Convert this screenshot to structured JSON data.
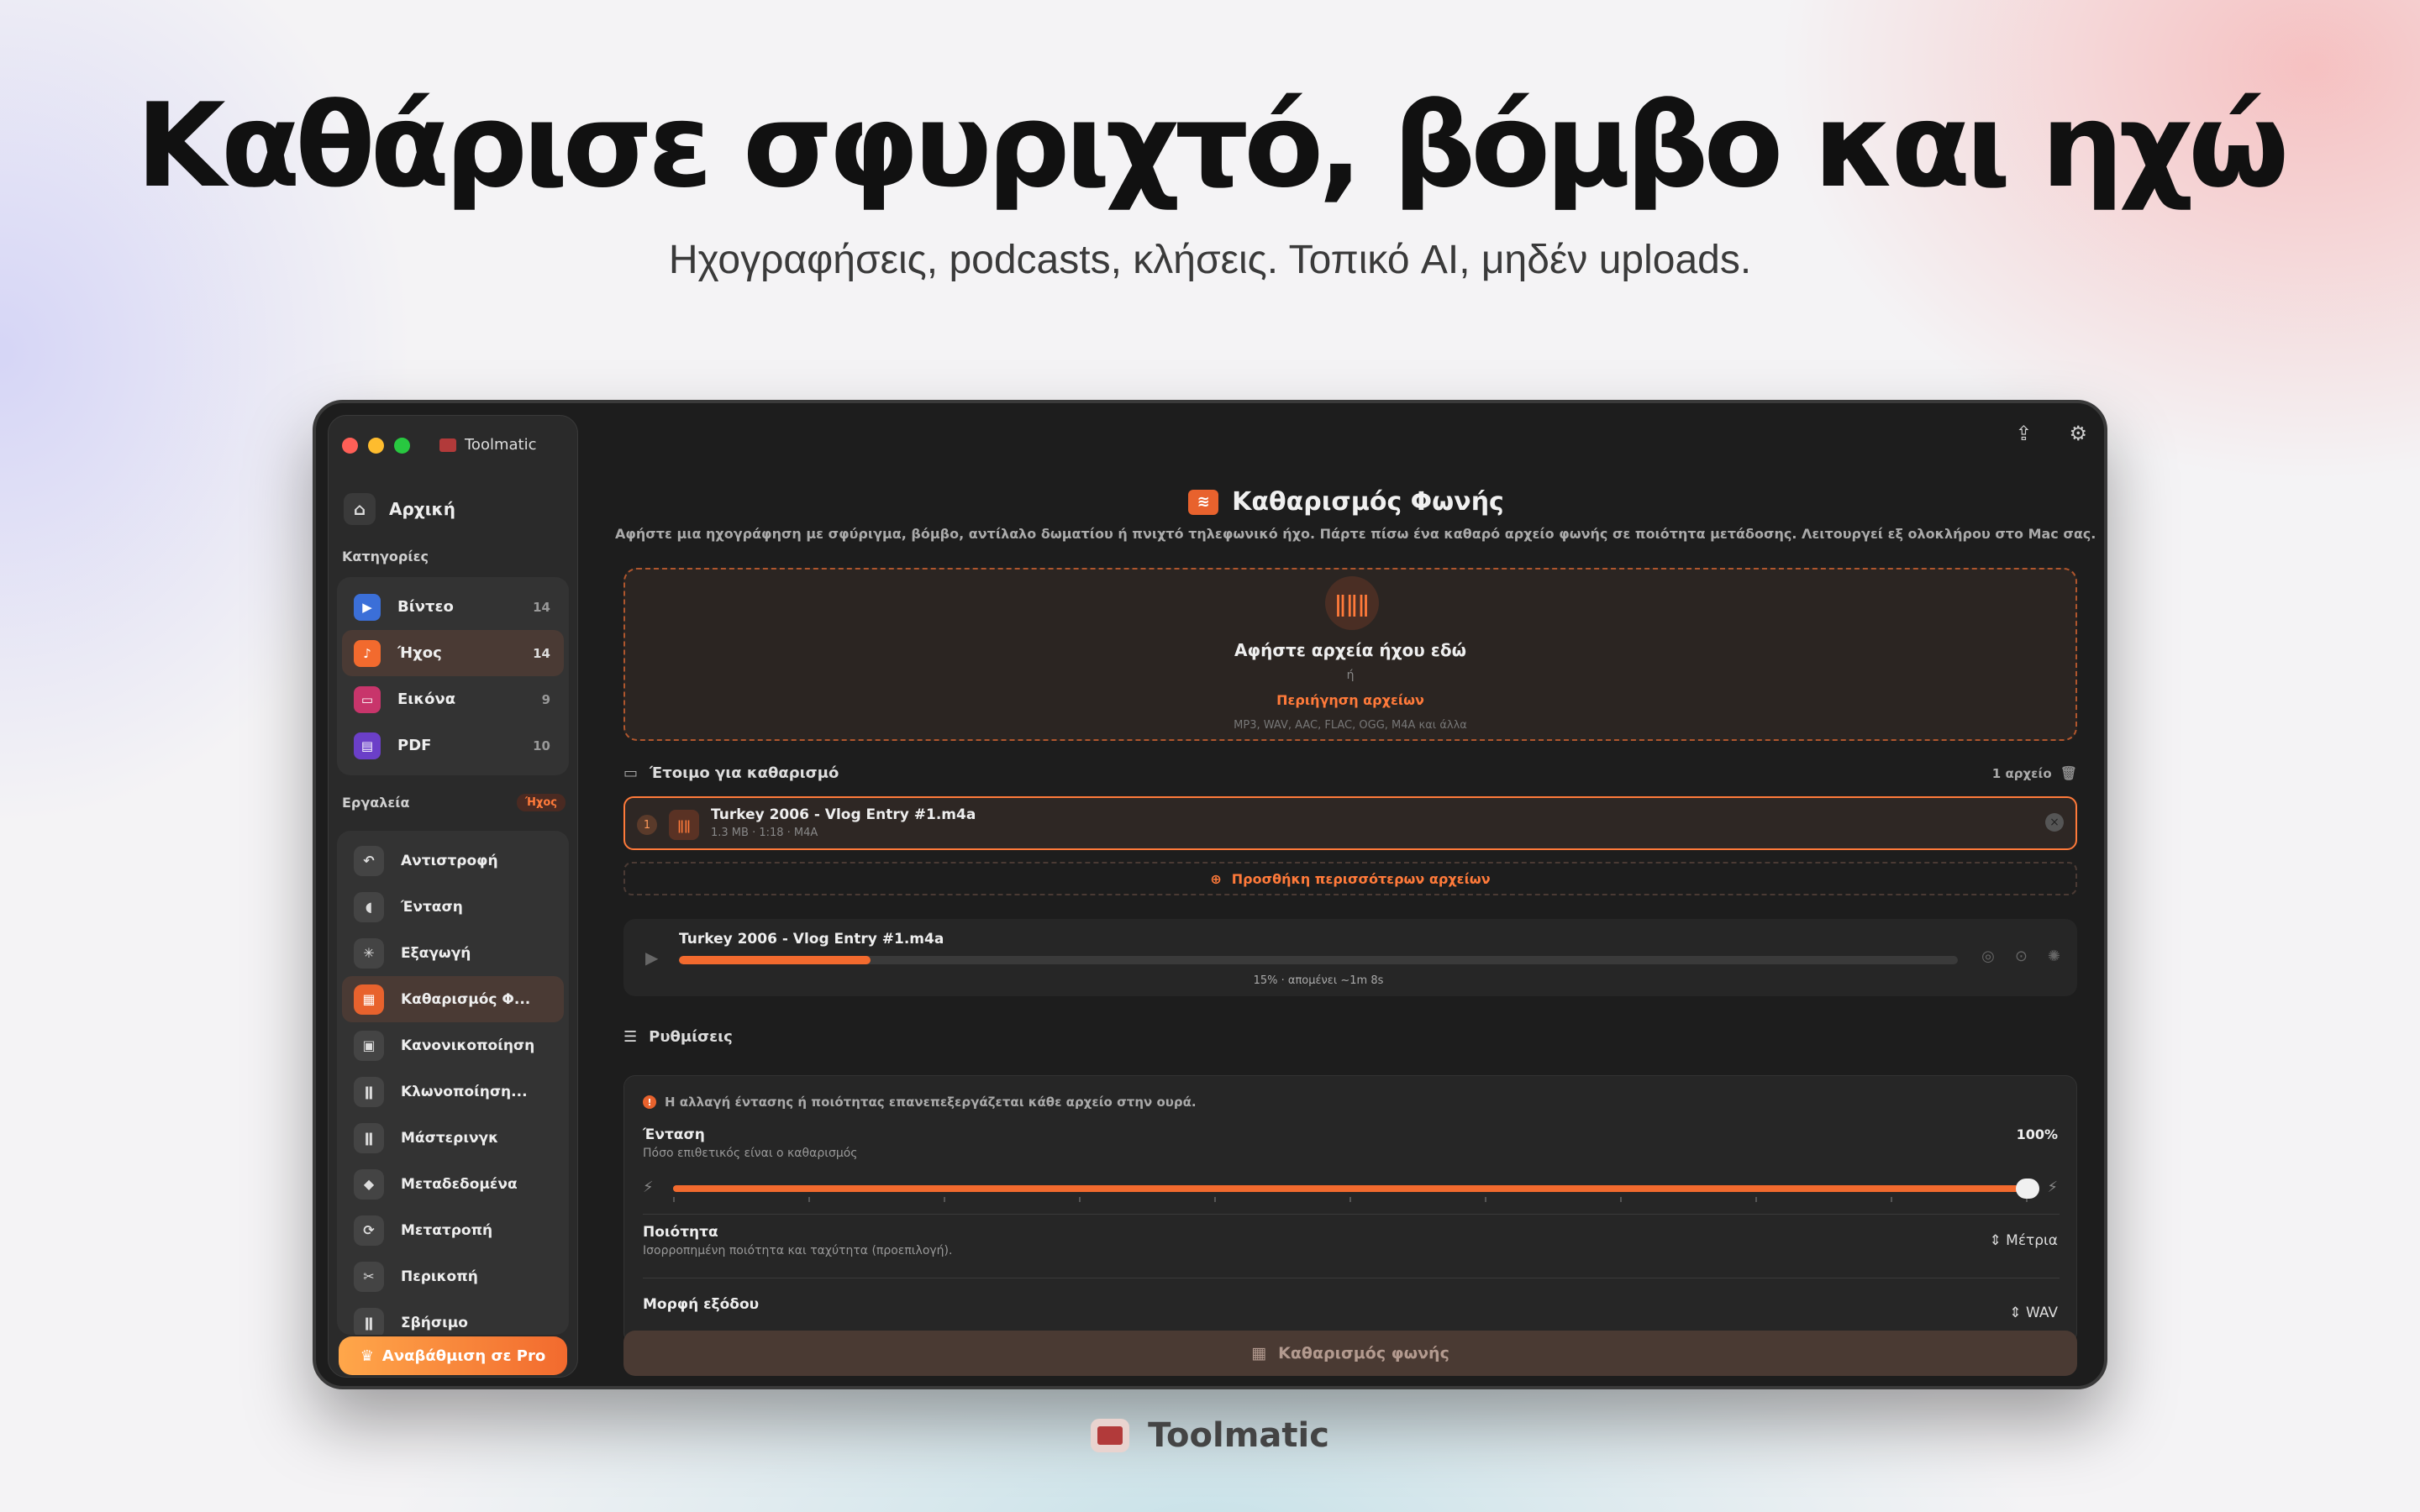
{
  "hero": {
    "headline": "Καθάρισε σφυριχτό, βόμβο και ηχώ",
    "subline": "Ηχογραφήσεις, podcasts, κλήσεις. Τοπικό AI, μηδέν uploads."
  },
  "window": {
    "app_title": "Toolmatic"
  },
  "sidebar": {
    "home_label": "Αρχική",
    "categories_label": "Κατηγορίες",
    "categories": [
      {
        "label": "Βίντεο",
        "count": "14",
        "color": "#3b6fd8",
        "icon": "play-icon"
      },
      {
        "label": "Ήχος",
        "count": "14",
        "color": "#f26a2e",
        "icon": "music-note-icon"
      },
      {
        "label": "Εικόνα",
        "count": "9",
        "color": "#c8356b",
        "icon": "image-icon"
      },
      {
        "label": "PDF",
        "count": "10",
        "color": "#6b3fc8",
        "icon": "document-icon"
      }
    ],
    "tools_label": "Εργαλεία",
    "tools_badge": "Ήχος",
    "tools": [
      {
        "label": "Αντιστροφή",
        "icon": "undo-icon"
      },
      {
        "label": "Ένταση",
        "icon": "speaker-icon"
      },
      {
        "label": "Εξαγωγή",
        "icon": "waveform-icon"
      },
      {
        "label": "Καθαρισμός Φ...",
        "icon": "voice-clean-icon"
      },
      {
        "label": "Κανονικοποίηση",
        "icon": "normalize-icon"
      },
      {
        "label": "Κλωνοποίηση...",
        "icon": "waveform-clone-icon"
      },
      {
        "label": "Μάστερινγκ",
        "icon": "mastering-icon"
      },
      {
        "label": "Μεταδεδομένα",
        "icon": "tag-icon"
      },
      {
        "label": "Μετατροπή",
        "icon": "convert-icon"
      },
      {
        "label": "Περικοπή",
        "icon": "scissors-icon"
      },
      {
        "label": "Σβήσιμο",
        "icon": "fade-icon"
      }
    ],
    "upgrade_label": "Αναβάθμιση σε Pro"
  },
  "main": {
    "title": "Καθαρισμός Φωνής",
    "description": "Αφήστε μια ηχογράφηση με σφύριγμα, βόμβο, αντίλαλο δωματίου ή πνιχτό τηλεφωνικό ήχο. Πάρτε πίσω ένα καθαρό αρχείο φωνής σε ποιότητα μετάδοσης. Λειτουργεί εξ ολοκλήρου στο Mac σας.",
    "dropzone": {
      "main": "Αφήστε αρχεία ήχου εδώ",
      "or": "ή",
      "browse": "Περιήγηση αρχείων",
      "formats": "MP3, WAV, AAC, FLAC, OGG, M4A και άλλα"
    },
    "queue": {
      "title": "Έτοιμο για καθαρισμό",
      "count": "1 αρχείο",
      "file": {
        "index": "1",
        "name": "Turkey 2006 - Vlog Entry #1.m4a",
        "meta": "1.3 MB · 1:18 · M4A"
      },
      "add_more": "Προσθήκη περισσότερων αρχείων"
    },
    "progress": {
      "name": "Turkey 2006 - Vlog Entry #1.m4a",
      "percent": 0.15,
      "status": "15% · απομένει ~1m 8s"
    },
    "settings": {
      "title": "Ρυθμίσεις",
      "warning": "Η αλλαγή έντασης ή ποιότητας επανεπεξεργάζεται κάθε αρχείο στην ουρά.",
      "intensity_label": "Ένταση",
      "intensity_sub": "Πόσο επιθετικός είναι ο καθαρισμός",
      "intensity_value": "100%",
      "intensity_level": 1.0,
      "quality_label": "Ποιότητα",
      "quality_sub": "Ισορροπημένη ποιότητα και ταχύτητα (προεπιλογή).",
      "quality_value": "Μέτρια",
      "format_label": "Μορφή εξόδου",
      "format_value": "WAV"
    },
    "action_label": "Καθαρισμός φωνής"
  },
  "footer": {
    "brand": "Toolmatic"
  },
  "colors": {
    "accent": "#f26a2e",
    "accent_light": "#ff7a3a"
  }
}
